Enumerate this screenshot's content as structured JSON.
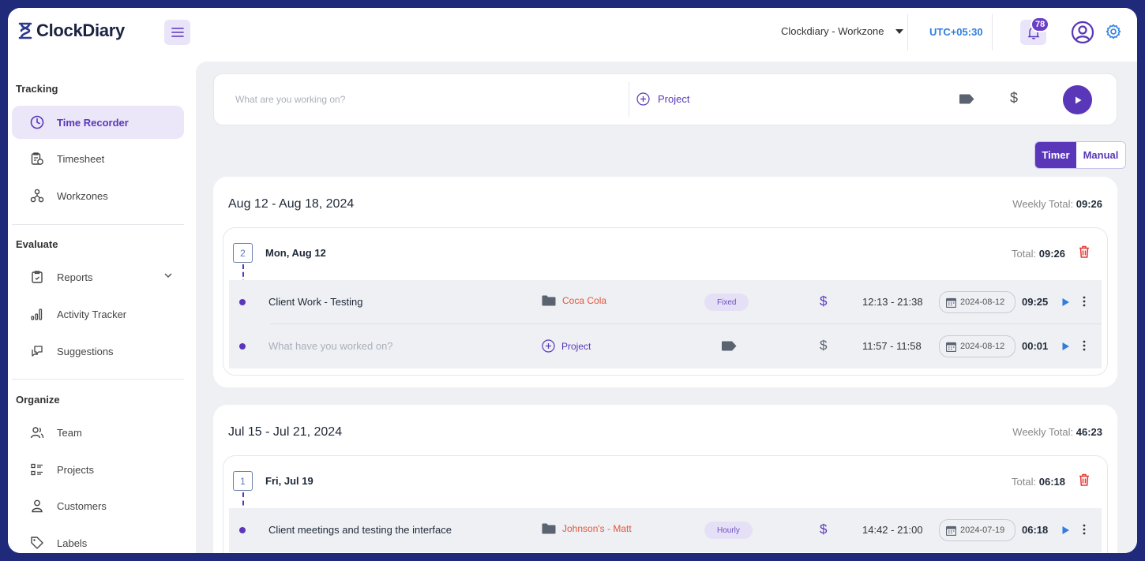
{
  "app": {
    "name": "ClockDiary"
  },
  "header": {
    "workspace": "Clockdiary - Workzone",
    "timezone": "UTC+05:30",
    "notifications_count": "78"
  },
  "sidebar": {
    "sections": [
      {
        "title": "Tracking",
        "items": [
          {
            "label": "Time Recorder",
            "icon": "clock-icon",
            "active": true
          },
          {
            "label": "Timesheet",
            "icon": "timesheet-icon"
          },
          {
            "label": "Workzones",
            "icon": "workzones-icon"
          }
        ]
      },
      {
        "title": "Evaluate",
        "items": [
          {
            "label": "Reports",
            "icon": "reports-icon",
            "expandable": true
          },
          {
            "label": "Activity Tracker",
            "icon": "bar-chart-icon"
          },
          {
            "label": "Suggestions",
            "icon": "suggestions-icon"
          }
        ]
      },
      {
        "title": "Organize",
        "items": [
          {
            "label": "Team",
            "icon": "team-icon"
          },
          {
            "label": "Projects",
            "icon": "projects-icon"
          },
          {
            "label": "Customers",
            "icon": "customer-icon"
          },
          {
            "label": "Labels",
            "icon": "label-icon"
          }
        ]
      }
    ]
  },
  "timer_bar": {
    "placeholder": "What are you working on?",
    "project_label": "Project"
  },
  "mode_toggle": {
    "timer": "Timer",
    "manual": "Manual"
  },
  "weeks": [
    {
      "range": "Aug 12 - Aug 18, 2024",
      "total_label": "Weekly Total:",
      "total": "09:26",
      "days": [
        {
          "count": "2",
          "label": "Mon, Aug 12",
          "total_label": "Total:",
          "total": "09:26",
          "entries": [
            {
              "description": "Client Work - Testing",
              "project": "Coca Cola",
              "billing": "Fixed",
              "time_range": "12:13 - 21:38",
              "date": "2024-08-12",
              "duration": "09:25"
            },
            {
              "description": "What have you worked on?",
              "project": "Project",
              "billing": "",
              "time_range": "11:57 - 11:58",
              "date": "2024-08-12",
              "duration": "00:01"
            }
          ]
        }
      ]
    },
    {
      "range": "Jul 15 - Jul 21, 2024",
      "total_label": "Weekly Total:",
      "total": "46:23",
      "days": [
        {
          "count": "1",
          "label": "Fri, Jul 19",
          "total_label": "Total:",
          "total": "06:18",
          "entries": [
            {
              "description": "Client meetings and testing the interface",
              "project": "Johnson's - Matt",
              "billing": "Hourly",
              "time_range": "14:42 - 21:00",
              "date": "2024-07-19",
              "duration": "06:18"
            }
          ]
        }
      ]
    }
  ],
  "colors": {
    "accent": "#5a37b8",
    "project_text": "#e4553c",
    "timezone": "#2f7de1",
    "trash": "#e53935",
    "frame": "#1f2a7a"
  }
}
